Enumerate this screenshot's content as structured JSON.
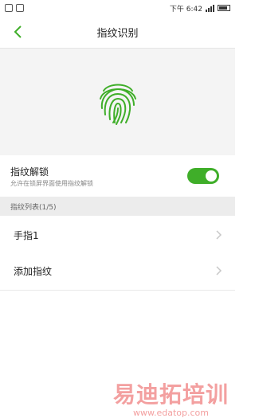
{
  "status_bar": {
    "time": "下午 6:42"
  },
  "header": {
    "title": "指纹识别"
  },
  "toggle": {
    "title": "指纹解锁",
    "subtitle": "允许在锁屏界面使用指纹解锁",
    "state": "on"
  },
  "section": {
    "label": "指纹列表(1/5)"
  },
  "list": [
    {
      "label": "手指1"
    },
    {
      "label": "添加指纹"
    }
  ],
  "watermark": {
    "title": "易迪拓培训",
    "url": "www.edatop.com"
  },
  "colors": {
    "accent": "#3fae29"
  }
}
